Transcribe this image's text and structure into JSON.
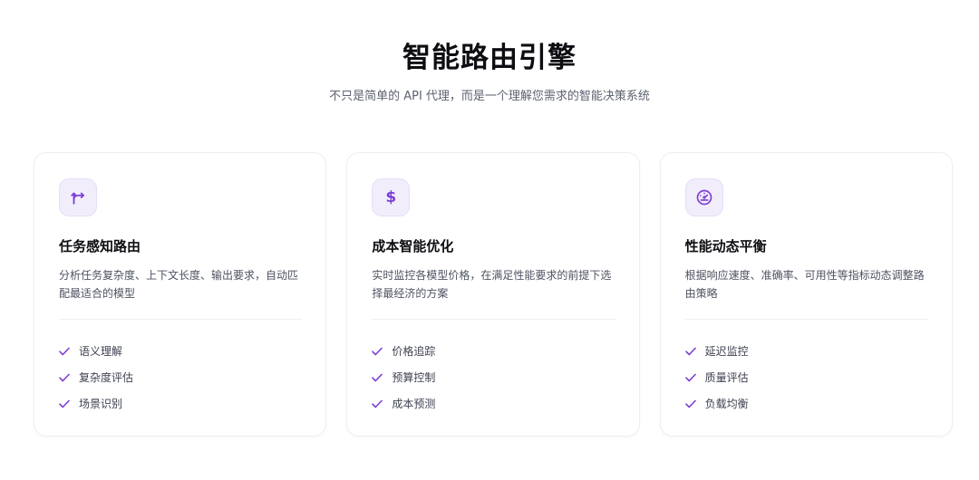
{
  "header": {
    "title": "智能路由引擎",
    "subtitle": "不只是简单的 API 代理，而是一个理解您需求的智能决策系统"
  },
  "colors": {
    "accent": "#7c3fd4",
    "icon_bg": "#f1edfb",
    "title": "#0d0d12",
    "body_text": "#4d5260",
    "card_border": "#eeeef3"
  },
  "cards": [
    {
      "icon": "route-split-icon",
      "title": "任务感知路由",
      "description": "分析任务复杂度、上下文长度、输出要求，自动匹配最适合的模型",
      "features": [
        "语义理解",
        "复杂度评估",
        "场景识别"
      ]
    },
    {
      "icon": "dollar-icon",
      "icon_glyph": "$",
      "title": "成本智能优化",
      "description": "实时监控各模型价格，在满足性能要求的前提下选择最经济的方案",
      "features": [
        "价格追踪",
        "预算控制",
        "成本预测"
      ]
    },
    {
      "icon": "gauge-icon",
      "title": "性能动态平衡",
      "description": "根据响应速度、准确率、可用性等指标动态调整路由策略",
      "features": [
        "延迟监控",
        "质量评估",
        "负载均衡"
      ]
    }
  ]
}
